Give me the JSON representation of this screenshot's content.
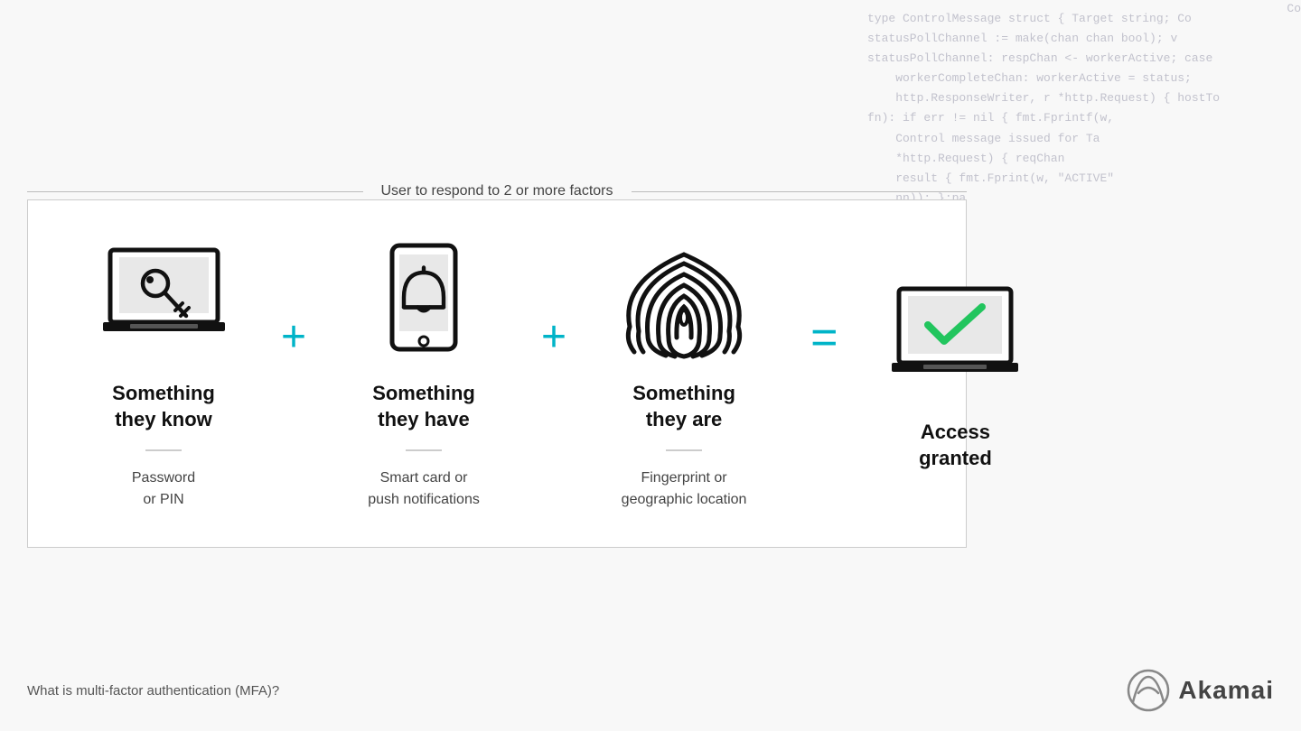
{
  "code_background": "type ControlMessage struct { Target string; Co\nstatusPollChannel := make(chan chan bool); v\nstatusPollChannel: respChan <- workerActive; case\n     workerCompleteChan: workerActive = status;\n     http.ResponseWriter, r *http.Request) { hostTo\nfn): if err != nil { fmt.Fprintf(w,\n     Control message issued for Ta\n     *http.Request) { reqChan\n     result { fmt.Fprint(w, \"ACTIVE\"\n     nn)); };pa\n     func ma\n     workerApt\n     msg re s\n     sdmin()\n     setToken\n     \n     r.w",
  "box_title": "User to respond to 2 or more factors",
  "factors": [
    {
      "id": "know",
      "title": "Something\nthey know",
      "subtitle": "Password\nor PIN"
    },
    {
      "id": "have",
      "title": "Something\nthey have",
      "subtitle": "Smart card or\npush notifications"
    },
    {
      "id": "are",
      "title": "Something\nthey are",
      "subtitle": "Fingerprint or\ngeographic location"
    }
  ],
  "result": {
    "title": "Access\ngranted"
  },
  "operators": {
    "plus": "+",
    "equals": "="
  },
  "bottom": {
    "label": "What is multi-factor authentication (MFA)?",
    "logo_text": "Akamai"
  },
  "corner_text": "Co"
}
